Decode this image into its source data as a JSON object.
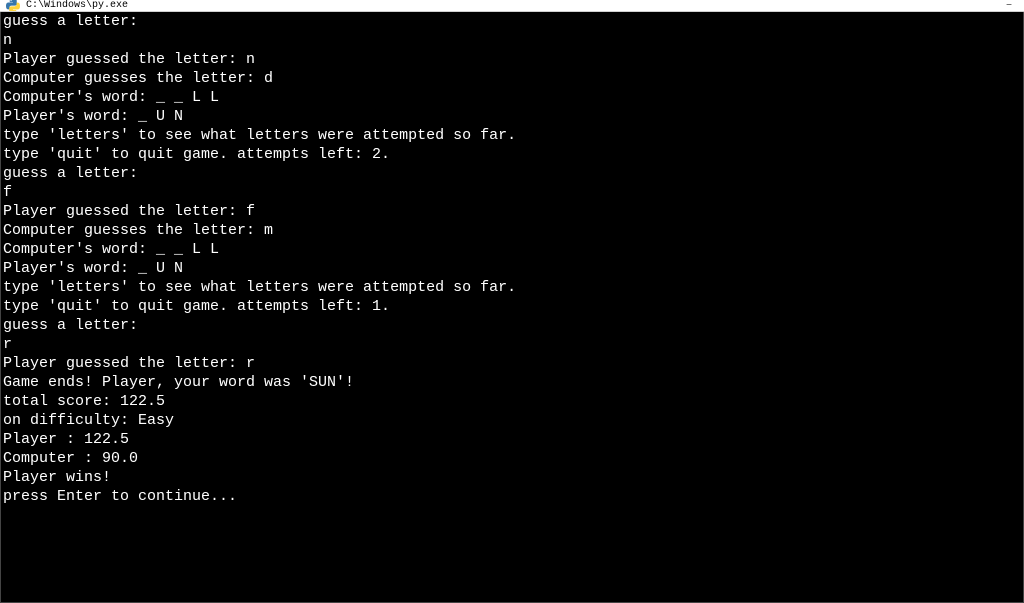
{
  "titlebar": {
    "text": "C:\\Windows\\py.exe"
  },
  "terminal": {
    "lines": [
      "guess a letter:",
      "n",
      "Player guessed the letter: n",
      "Computer guesses the letter: d",
      "Computer's word: _ _ L L",
      "Player's word: _ U N",
      "type 'letters' to see what letters were attempted so far.",
      "type 'quit' to quit game. attempts left: 2.",
      "guess a letter:",
      "f",
      "Player guessed the letter: f",
      "Computer guesses the letter: m",
      "Computer's word: _ _ L L",
      "Player's word: _ U N",
      "type 'letters' to see what letters were attempted so far.",
      "type 'quit' to quit game. attempts left: 1.",
      "guess a letter:",
      "r",
      "Player guessed the letter: r",
      "",
      "Game ends! Player, your word was 'SUN'!",
      "total score: 122.5",
      "on difficulty: Easy",
      "Player : 122.5",
      "Computer : 90.0",
      "",
      "Player wins!",
      "",
      "press Enter to continue..."
    ]
  }
}
